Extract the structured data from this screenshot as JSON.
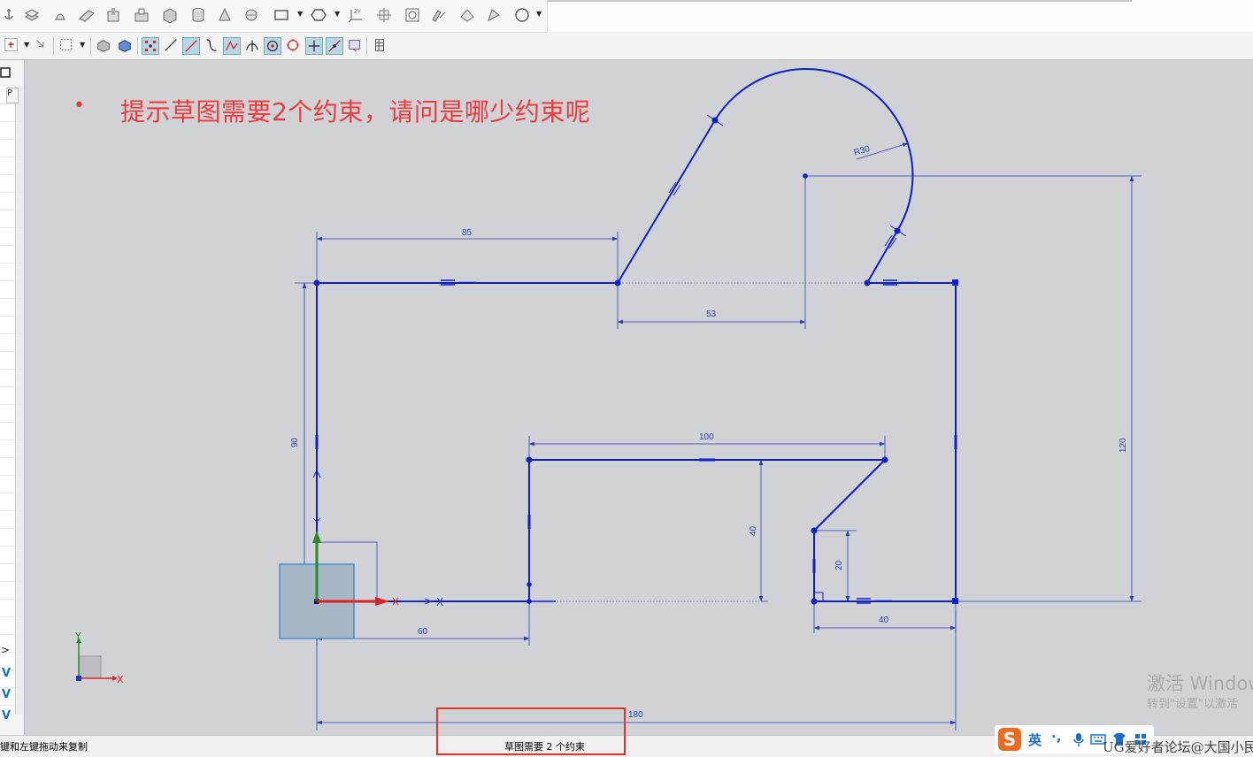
{
  "toolbar_top": {
    "icons": [
      "anchor-icon",
      "extrude-icon",
      "revolve-icon",
      "sweep-icon",
      "hole-icon",
      "boss-icon",
      "block-icon",
      "cylinder-icon",
      "cone-icon",
      "sphere-icon",
      "rectangle-icon",
      "polygon-icon",
      "coordinate-system-icon",
      "datum-plane-icon",
      "point-icon",
      "mirror-icon",
      "pattern-icon",
      "blend-icon",
      "circle-icon"
    ]
  },
  "toolbar_sketch": {
    "icons": [
      "sketch-origin-icon",
      "move-icon",
      "selection-box-icon",
      "shade-icon",
      "shaded-edges-icon",
      "snap-point-icon",
      "line-icon",
      "constraint-line-icon",
      "curve-icon",
      "spline-icon",
      "intersection-icon",
      "circle-center-icon",
      "circle-icon",
      "cross-point-icon",
      "slope-icon",
      "view-icon",
      "grid-icon"
    ]
  },
  "left_panel": {
    "tab_label": "P",
    "expand_arrow": ">",
    "chevrons": [
      "V",
      "V",
      "V"
    ]
  },
  "annotation": {
    "bullet": "•",
    "text": "提示草图需要2个约束，请问是哪少约束呢"
  },
  "sketch": {
    "dimensions": {
      "d85": "85",
      "d53": "53",
      "r30": "R30",
      "d90": "90",
      "d100": "100",
      "d40v": "40",
      "d20": "20",
      "d120": "120",
      "d60": "60",
      "d40h": "40",
      "d180": "180"
    },
    "axis_x": "X",
    "triad_x": "X",
    "triad_y": "Y"
  },
  "watermark": {
    "line1": "激活 Window",
    "line2": "转到\"设置\"以激活"
  },
  "status": {
    "left": "键和左键拖动来复制",
    "center": "草图需要 2 个约束"
  },
  "ime": {
    "logo": "S",
    "lang": "英",
    "punct": "·,"
  },
  "forum_watermark": "UG爱好者论坛@大国小民",
  "colors": {
    "sketch_line": "#0a1ed2",
    "dimension": "#2a3fb8",
    "annotation": "#f03a3a",
    "canvas": "#d1d2d5",
    "highlight_box": "#e0302b"
  }
}
